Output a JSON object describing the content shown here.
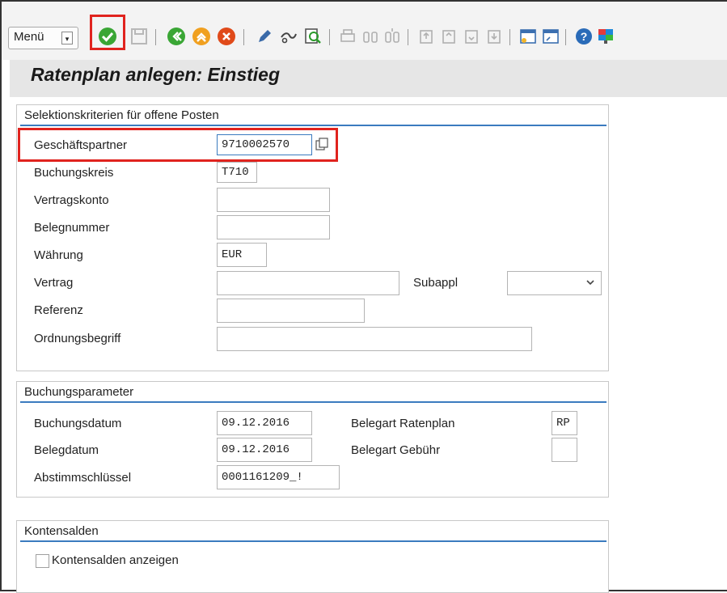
{
  "toolbar": {
    "menu_label": "Menü",
    "icons": [
      "ok-icon",
      "save-icon",
      "back-icon",
      "exit-icon",
      "cancel-icon",
      "edit-icon",
      "display-icon",
      "find-icon",
      "print-icon",
      "search-icon",
      "search-next-icon",
      "first-page-icon",
      "prev-page-icon",
      "next-page-icon",
      "last-page-icon",
      "new-session-icon",
      "shortcut-icon",
      "help-icon",
      "layout-icon"
    ],
    "colors": {
      "ok": "#3aa635",
      "back": "#3aa635",
      "exit": "#f0a020",
      "cancel": "#e04a1a",
      "help": "#2a6bb8",
      "highlight": "#e0231e"
    }
  },
  "title": "Ratenplan anlegen: Einstieg",
  "selection": {
    "title": "Selektionskriterien für offene Posten",
    "geschaeftspartner": {
      "label": "Geschäftspartner",
      "value": "9710002570"
    },
    "buchungskreis": {
      "label": "Buchungskreis",
      "value": "T710"
    },
    "vertragskonto": {
      "label": "Vertragskonto",
      "value": ""
    },
    "belegnummer": {
      "label": "Belegnummer",
      "value": ""
    },
    "waehrung": {
      "label": "Währung",
      "value": "EUR"
    },
    "vertrag": {
      "label": "Vertrag",
      "value": ""
    },
    "subappl": {
      "label": "Subappl",
      "value": ""
    },
    "referenz": {
      "label": "Referenz",
      "value": ""
    },
    "ordnungsbegriff": {
      "label": "Ordnungsbegriff",
      "value": ""
    }
  },
  "buchung": {
    "title": "Buchungsparameter",
    "buchungsdatum": {
      "label": "Buchungsdatum",
      "value": "09.12.2016"
    },
    "belegdatum": {
      "label": "Belegdatum",
      "value": "09.12.2016"
    },
    "abstimmschluessel": {
      "label": "Abstimmschlüssel",
      "value": "0001161209_!"
    },
    "belegart_ratenplan": {
      "label": "Belegart Ratenplan",
      "value": "RP"
    },
    "belegart_gebuehr": {
      "label": "Belegart Gebühr",
      "value": ""
    }
  },
  "konten": {
    "title": "Kontensalden",
    "checkbox_label": "Kontensalden anzeigen",
    "checked": false
  }
}
